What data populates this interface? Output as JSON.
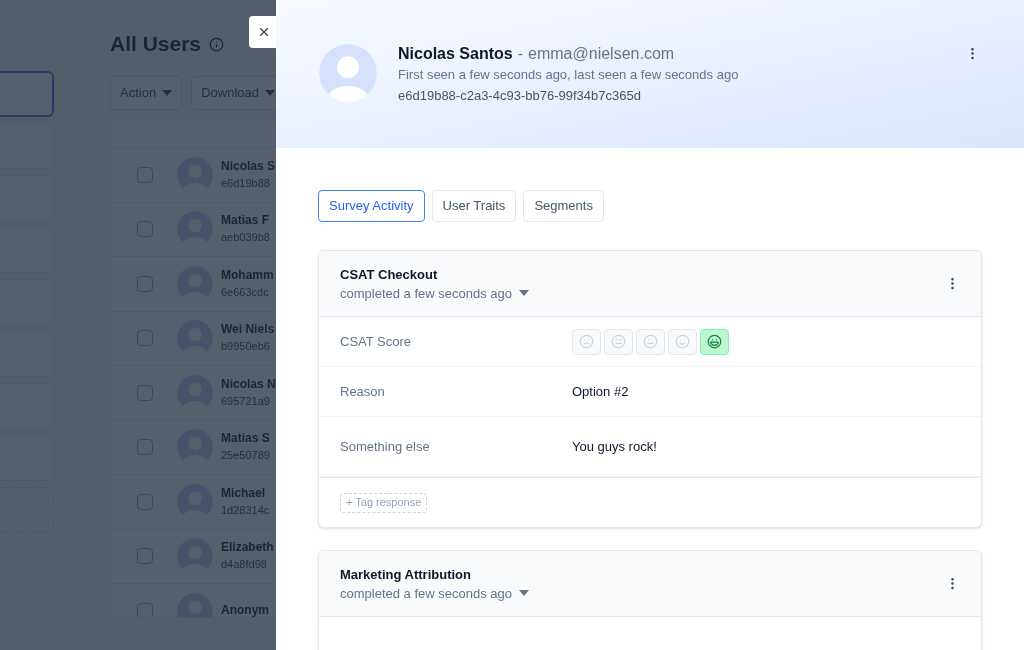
{
  "background": {
    "heading": "All Users",
    "buttons": [
      "Action",
      "Download"
    ],
    "filters": [
      {
        "kind": "card",
        "selected": true
      },
      {
        "kind": "card",
        "selected": false
      },
      {
        "kind": "card",
        "selected": false
      },
      {
        "kind": "card",
        "selected": false
      },
      {
        "kind": "card",
        "selected": false
      },
      {
        "kind": "card",
        "selected": false
      },
      {
        "kind": "card",
        "selected": false
      },
      {
        "kind": "card",
        "selected": false
      },
      {
        "kind": "add",
        "selected": false
      }
    ],
    "users": [
      {
        "name": "Nicolas S",
        "id": "e6d19b88",
        "checked": false
      },
      {
        "name": "Matias F",
        "id": "aeb039b8",
        "checked": false
      },
      {
        "name": "Mohamm",
        "id": "6e663cdc",
        "checked": false
      },
      {
        "name": "Wei Niels",
        "id": "b9950eb6",
        "checked": false
      },
      {
        "name": "Nicolas N",
        "id": "695721a9",
        "checked": false
      },
      {
        "name": "Matias S",
        "id": "25e50789",
        "checked": false
      },
      {
        "name": "Michael",
        "id": "1d28314c",
        "checked": false
      },
      {
        "name": "Elizabeth",
        "id": "d4a8fd98",
        "checked": false
      },
      {
        "name": "Anonym",
        "checked": false
      }
    ]
  },
  "panel": {
    "profile": {
      "name": "Nicolas Santos",
      "separator": "-",
      "email": "emma@nielsen.com",
      "seen": "First seen a few seconds ago, last seen a few seconds ago",
      "user_id": "e6d19b88-c2a3-4c93-bb76-99f34b7c365d"
    },
    "tabs": [
      {
        "label": "Survey Activity",
        "selected": true
      },
      {
        "label": "User Traits",
        "selected": false
      },
      {
        "label": "Segments",
        "selected": false
      }
    ],
    "responses": [
      {
        "title": "CSAT Checkout",
        "status": "completed a few seconds ago",
        "fields": [
          {
            "kind": "rating",
            "label": "CSAT Score",
            "options": [
              {
                "selected": false
              },
              {
                "selected": false
              },
              {
                "selected": false
              },
              {
                "selected": false
              },
              {
                "selected": true
              }
            ]
          },
          {
            "kind": "text",
            "label": "Reason",
            "value": "Option #2"
          },
          {
            "kind": "text",
            "label": "Something else",
            "value": "You guys rock!"
          }
        ],
        "tag_label": "+ Tag response"
      },
      {
        "title": "Marketing Attribution",
        "status": "completed a few seconds ago"
      }
    ]
  }
}
